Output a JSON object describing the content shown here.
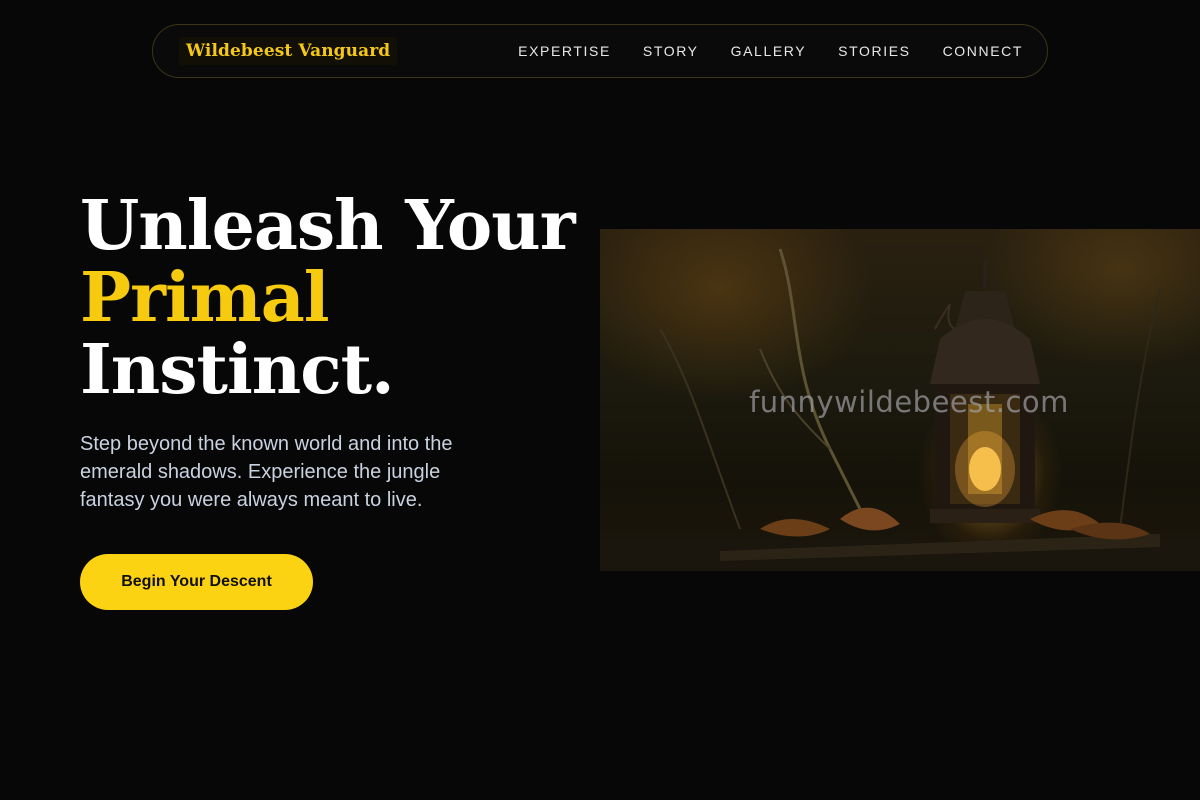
{
  "brand": {
    "name": "Wildebeest Vanguard"
  },
  "nav": {
    "items": [
      {
        "label": "EXPERTISE"
      },
      {
        "label": "STORY"
      },
      {
        "label": "GALLERY"
      },
      {
        "label": "STORIES"
      },
      {
        "label": "CONNECT"
      }
    ]
  },
  "hero": {
    "headline_line1": "Unleash Your",
    "headline_accent": "Primal",
    "headline_line3": "Instinct.",
    "subtext": "Step beyond the known world and into the emerald shadows. Experience the jungle fantasy you were always meant to live.",
    "cta_label": "Begin Your Descent",
    "image_watermark": "funnywildebeest.com"
  },
  "colors": {
    "background": "#070707",
    "accent": "#f6ca0e",
    "button": "#fcd312",
    "body_text": "#c9d2e0"
  }
}
